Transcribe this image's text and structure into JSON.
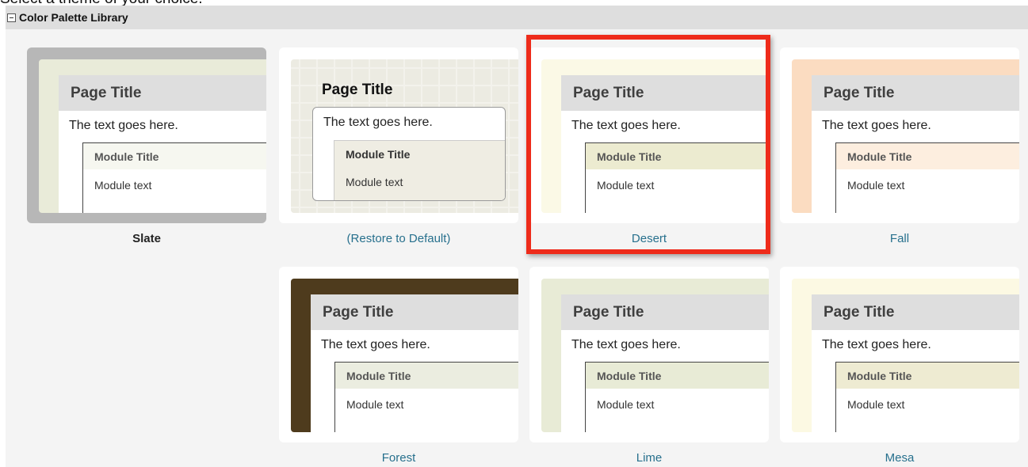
{
  "intro_text": "Select a theme of your choice.",
  "section": {
    "title": "Color Palette Library",
    "toggle_icon": "minus-box-icon"
  },
  "preview_text": {
    "page_title": "Page Title",
    "body_text": "The text goes here.",
    "module_title": "Module Title",
    "module_text": "Module text"
  },
  "themes": [
    {
      "label": "Slate",
      "state": "current",
      "bg": "#e9ebd9",
      "module_bar": "#f6f7f0",
      "frame": "#b7b7b7"
    },
    {
      "label": "(Restore to Default)",
      "state": "default",
      "bg": "#ecebe2",
      "module_bar": "#efede3"
    },
    {
      "label": "Desert",
      "state": "highlighted",
      "bg": "#fbf9e6",
      "module_bar": "#ecebd0"
    },
    {
      "label": "Fall",
      "state": "normal",
      "bg": "#fbdcc1",
      "module_bar": "#fdeedf"
    },
    {
      "label": "Forest",
      "state": "normal",
      "bg": "#4e3b1d",
      "module_bar": "#ebede0"
    },
    {
      "label": "Lime",
      "state": "normal",
      "bg": "#e8ebd6",
      "module_bar": "#e8ebd6"
    },
    {
      "label": "Mesa",
      "state": "normal",
      "bg": "#fcf9e3",
      "module_bar": "#eeebd2"
    }
  ],
  "highlight_color": "#ee2b1a"
}
